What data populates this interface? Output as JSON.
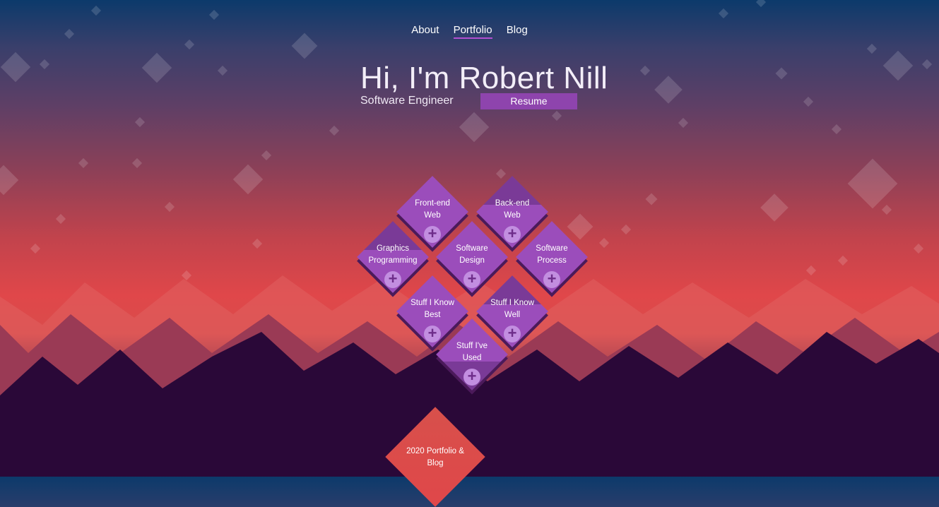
{
  "nav": {
    "items": [
      {
        "label": "About",
        "active": false
      },
      {
        "label": "Portfolio",
        "active": true
      },
      {
        "label": "Blog",
        "active": false
      }
    ]
  },
  "hero": {
    "name": "Hi, I'm Robert Nill",
    "subtitle": "Software Engineer",
    "resume_label": "Resume"
  },
  "skills": [
    {
      "line1": "Front-end",
      "line2": "Web",
      "icon": "plus-icon"
    },
    {
      "line1": "Back-end",
      "line2": "Web",
      "icon": "plus-icon"
    },
    {
      "line1": "Graphics",
      "line2": "Programming",
      "icon": "plus-icon"
    },
    {
      "line1": "Software",
      "line2": "Design",
      "icon": "plus-icon"
    },
    {
      "line1": "Software",
      "line2": "Process",
      "icon": "plus-icon"
    },
    {
      "line1": "Stuff I Know",
      "line2": "Best",
      "icon": "plus-icon"
    },
    {
      "line1": "Stuff I Know",
      "line2": "Well",
      "icon": "plus-icon"
    },
    {
      "line1": "Stuff I've",
      "line2": "Used",
      "icon": "plus-icon"
    }
  ],
  "footer_tile": {
    "line1": "2020 Portfolio &",
    "line2": "Blog"
  },
  "colors": {
    "accent": "#8e44ad",
    "tile": "#9b4dbb",
    "tile_shadow": "#4b1a5a",
    "plus_bg": "#c28ee0",
    "ground": "#2a0838"
  }
}
